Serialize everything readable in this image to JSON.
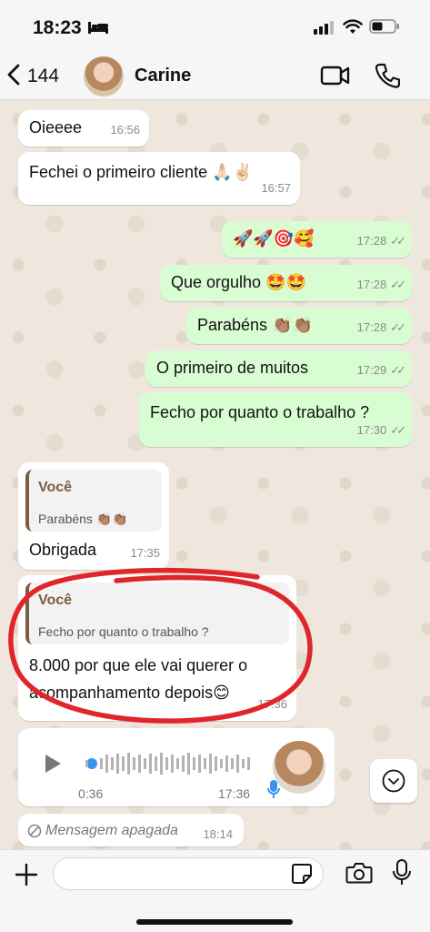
{
  "status": {
    "time": "18:23"
  },
  "header": {
    "back_count": "144",
    "contact_name": "Carine"
  },
  "messages": [
    {
      "text": "Oieeee",
      "time": "16:56"
    },
    {
      "text": "Fechei o primeiro cliente 🙏🏻✌🏻",
      "time": "16:57"
    },
    {
      "text": "🚀🚀🎯🥰",
      "time": "17:28"
    },
    {
      "text": "Que orgulho 🤩🤩",
      "time": "17:28"
    },
    {
      "text": "Parabéns 👏🏽👏🏽",
      "time": "17:28"
    },
    {
      "text": "O primeiro de muitos",
      "time": "17:29"
    },
    {
      "text": "Fecho por quanto o trabalho ?",
      "time": "17:30"
    },
    {
      "quote_author": "Você",
      "quote_text": "Parabéns 👏🏽👏🏽",
      "text": "Obrigada",
      "time": "17:35"
    },
    {
      "quote_author": "Você",
      "quote_text": "Fecho por quanto o trabalho ?",
      "line1": "8.000 por que ele vai querer o",
      "line2": "acompanhamento depois😊",
      "time": "17:36"
    }
  ],
  "voice": {
    "duration": "0:36",
    "time": "17:36"
  },
  "deleted": {
    "text": "Mensagem apagada",
    "time": "18:14"
  },
  "composer": {
    "placeholder": ""
  },
  "colors": {
    "incoming": "#ffffff",
    "outgoing": "#d9fdd3",
    "annotation": "#e0262b",
    "quote_accent": "#7a5c3e"
  }
}
